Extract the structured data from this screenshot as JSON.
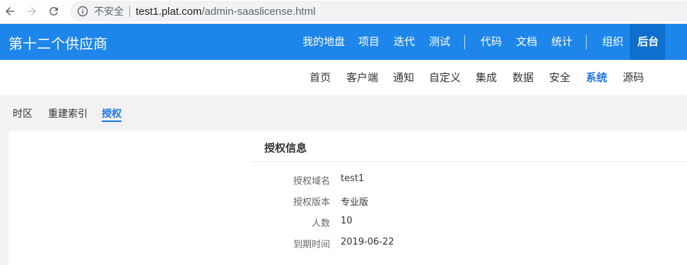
{
  "browser": {
    "security_label": "不安全",
    "url_host": "test1.plat.com",
    "url_path": "/admin-saaslicense.html"
  },
  "header": {
    "brand": "第十二个供应商",
    "nav_group1": [
      "我的地盘",
      "项目",
      "迭代",
      "测试"
    ],
    "nav_group2": [
      "代码",
      "文档",
      "统计"
    ],
    "nav_group3": [
      "组织",
      "后台"
    ],
    "active_item": "后台",
    "bar_color": "#1e86ea"
  },
  "subnav": {
    "items": [
      "首页",
      "客户端",
      "通知",
      "自定义",
      "集成",
      "数据",
      "安全",
      "系统",
      "源码"
    ],
    "active_item": "系统"
  },
  "tabs": {
    "items": [
      "时区",
      "重建索引",
      "授权"
    ],
    "active_item": "授权"
  },
  "license": {
    "title": "授权信息",
    "fields": [
      {
        "label": "授权域名",
        "value": "test1"
      },
      {
        "label": "授权版本",
        "value": "专业版"
      },
      {
        "label": "人数",
        "value": "10"
      },
      {
        "label": "到期时间",
        "value": "2019-06-22"
      }
    ]
  },
  "colors": {
    "accent": "#1a73e8",
    "active_header_tab": "#0f6fce"
  }
}
